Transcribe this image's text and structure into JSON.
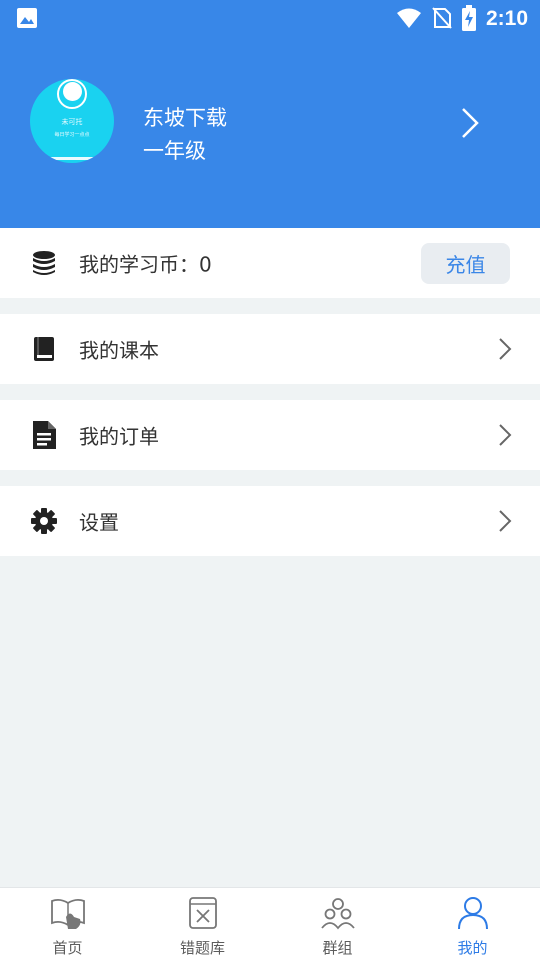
{
  "status_bar": {
    "time": "2:10"
  },
  "profile": {
    "name": "东坡下载",
    "grade": "一年级",
    "avatar_text_1": "未可托",
    "avatar_text_2": "每日学习一点点"
  },
  "coins": {
    "label": "我的学习币：0",
    "button_label": "充值"
  },
  "menu": [
    {
      "label": "我的课本",
      "icon": "book-icon"
    },
    {
      "label": "我的订单",
      "icon": "document-icon"
    },
    {
      "label": "设置",
      "icon": "gear-icon"
    }
  ],
  "tabs": [
    {
      "label": "首页",
      "icon": "home-book-icon",
      "active": false
    },
    {
      "label": "错题库",
      "icon": "wrong-questions-icon",
      "active": false
    },
    {
      "label": "群组",
      "icon": "group-icon",
      "active": false
    },
    {
      "label": "我的",
      "icon": "person-icon",
      "active": true
    }
  ],
  "colors": {
    "primary": "#3887e8",
    "accent": "#2d7be6",
    "background": "#eff3f4"
  }
}
